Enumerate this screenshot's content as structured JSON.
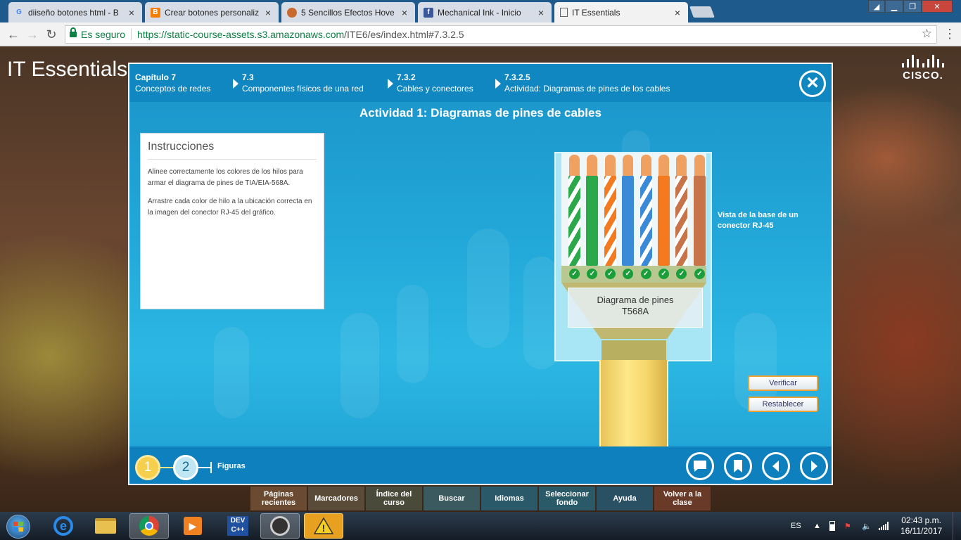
{
  "browser": {
    "tabs": [
      {
        "title": "diiseño botones html - B",
        "favicon": "google-icon"
      },
      {
        "title": "Crear botones personaliz",
        "favicon": "blogger-icon"
      },
      {
        "title": "5 Sencillos Efectos Hove",
        "favicon": "site-icon"
      },
      {
        "title": "Mechanical Ink - Inicio",
        "favicon": "facebook-icon"
      },
      {
        "title": "IT Essentials",
        "favicon": "page-icon"
      }
    ],
    "secure_label": "Es seguro",
    "url_host": "https://static-course-assets.s3.amazonaws.com",
    "url_path": "/ITE6/es/index.html#7.3.2.5"
  },
  "page": {
    "brand": "IT Essentials",
    "cisco": "CISCO."
  },
  "breadcrumbs": [
    {
      "num": "Capítulo 7",
      "label": "Conceptos de redes"
    },
    {
      "num": "7.3",
      "label": "Componentes físicos de una red"
    },
    {
      "num": "7.3.2",
      "label": "Cables y conectores"
    },
    {
      "num": "7.3.2.5",
      "label": "Actividad: Diagramas de pines de los cables"
    }
  ],
  "activity": {
    "title": "Actividad 1: Diagramas de pines de cables",
    "instructions_title": "Instrucciones",
    "instructions_p1": "Alinee correctamente los colores de los hilos para armar el diagrama de pines de TIA/EIA-568A.",
    "instructions_p2": "Arrastre cada color de hilo a la ubicación correcta en la imagen del conector RJ-45 del gráfico.",
    "diagram_label_1": "Diagrama de pines",
    "diagram_label_2": "T568A",
    "side_label": "Vista de la base de un conector RJ-45",
    "verify": "Verificar",
    "reset": "Restablecer",
    "wires": [
      {
        "stripe": "#ffffff",
        "color": "#2aa84a"
      },
      {
        "stripe": "#2aa84a",
        "color": "#2aa84a"
      },
      {
        "stripe": "#ffffff",
        "color": "#f47a20"
      },
      {
        "stripe": "#3a8ad8",
        "color": "#3a8ad8"
      },
      {
        "stripe": "#ffffff",
        "color": "#3a8ad8"
      },
      {
        "stripe": "#f47a20",
        "color": "#f47a20"
      },
      {
        "stripe": "#ffffff",
        "color": "#c8744a"
      },
      {
        "stripe": "#c8744a",
        "color": "#c8744a"
      }
    ]
  },
  "footer": {
    "step1": "1",
    "step2": "2",
    "figures": "Figuras"
  },
  "module_menu": [
    {
      "label": "Páginas recientes",
      "color": "#6a4a30"
    },
    {
      "label": "Marcadores",
      "color": "#5a4a38"
    },
    {
      "label": "Índice del curso",
      "color": "#4a4a3a"
    },
    {
      "label": "Buscar",
      "color": "#3a5a60"
    },
    {
      "label": "Idiomas",
      "color": "#2a5a6a"
    },
    {
      "label": "Seleccionar fondo",
      "color": "#2a5a68"
    },
    {
      "label": "Ayuda",
      "color": "#2a5064"
    },
    {
      "label": "Volver a la clase",
      "color": "#6a3a28"
    }
  ],
  "taskbar": {
    "lang": "ES",
    "time": "02:43 p.m.",
    "date": "16/11/2017"
  }
}
